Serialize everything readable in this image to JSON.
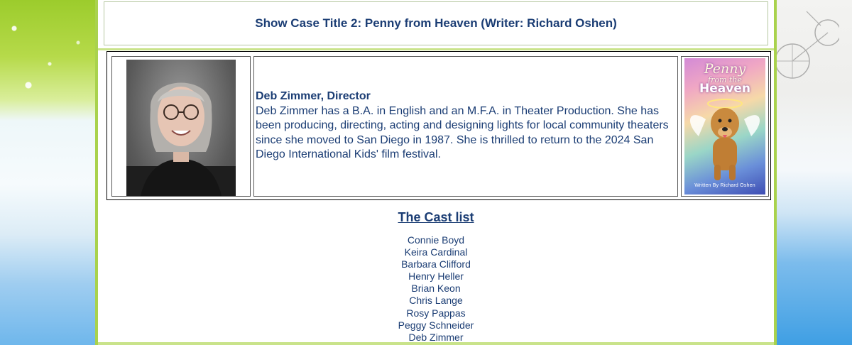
{
  "showcase": {
    "title": "Show Case Title 2: Penny from Heaven (Writer: Richard Oshen)"
  },
  "director": {
    "name": "Deb Zimmer, Director",
    "bio": "Deb Zimmer has a B.A. in English and an M.F.A. in Theater Production. She has been producing, directing, acting and designing lights for local community theaters since she moved to San Diego in 1987. She is thrilled to return to the 2024 San Diego International Kids' film festival."
  },
  "poster": {
    "title_top": "Penny",
    "title_mid": "from the",
    "title_bottom": "Heaven",
    "credit": "Written By Richard Oshen"
  },
  "cast": {
    "heading": "The Cast list ",
    "members": [
      "Connie Boyd",
      "Keira Cardinal",
      "Barbara Clifford",
      "Henry Heller",
      "Brian Keon",
      "Chris Lange",
      "Rosy Pappas",
      "Peggy Schneider",
      "Deb Zimmer"
    ]
  },
  "colors": {
    "text": "#1b3d74",
    "page_border": "#a9d24d",
    "divider": "#c9e38a"
  }
}
